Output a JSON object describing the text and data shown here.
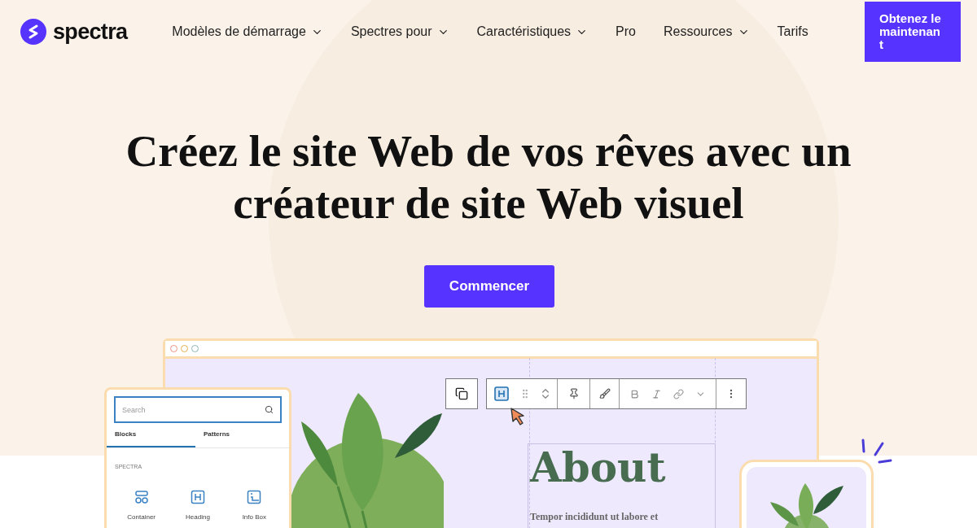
{
  "header": {
    "logo_text": "spectra",
    "nav": [
      {
        "label": "Modèles de démarrage",
        "has_caret": true
      },
      {
        "label": "Spectres pour",
        "has_caret": true
      },
      {
        "label": "Caractéristiques",
        "has_caret": true
      },
      {
        "label": "Pro",
        "has_caret": false
      },
      {
        "label": "Ressources",
        "has_caret": true
      },
      {
        "label": "Tarifs",
        "has_caret": false
      }
    ],
    "cta": "Obtenez le maintenan t"
  },
  "hero": {
    "title": "Créez le site Web de vos rêves avec un créateur de site Web visuel",
    "button": "Commencer"
  },
  "mockup": {
    "inserter": {
      "search_placeholder": "Search",
      "tabs": [
        {
          "label": "Blocks",
          "selected": true
        },
        {
          "label": "Patterns",
          "selected": false
        }
      ],
      "section": "SPECTRA",
      "blocks": [
        {
          "label": "Container",
          "kind": "container"
        },
        {
          "label": "Heading",
          "kind": "heading"
        },
        {
          "label": "Info Box",
          "kind": "infobox"
        }
      ]
    },
    "heading": "About",
    "body": "Tempor incididunt ut labore et"
  }
}
